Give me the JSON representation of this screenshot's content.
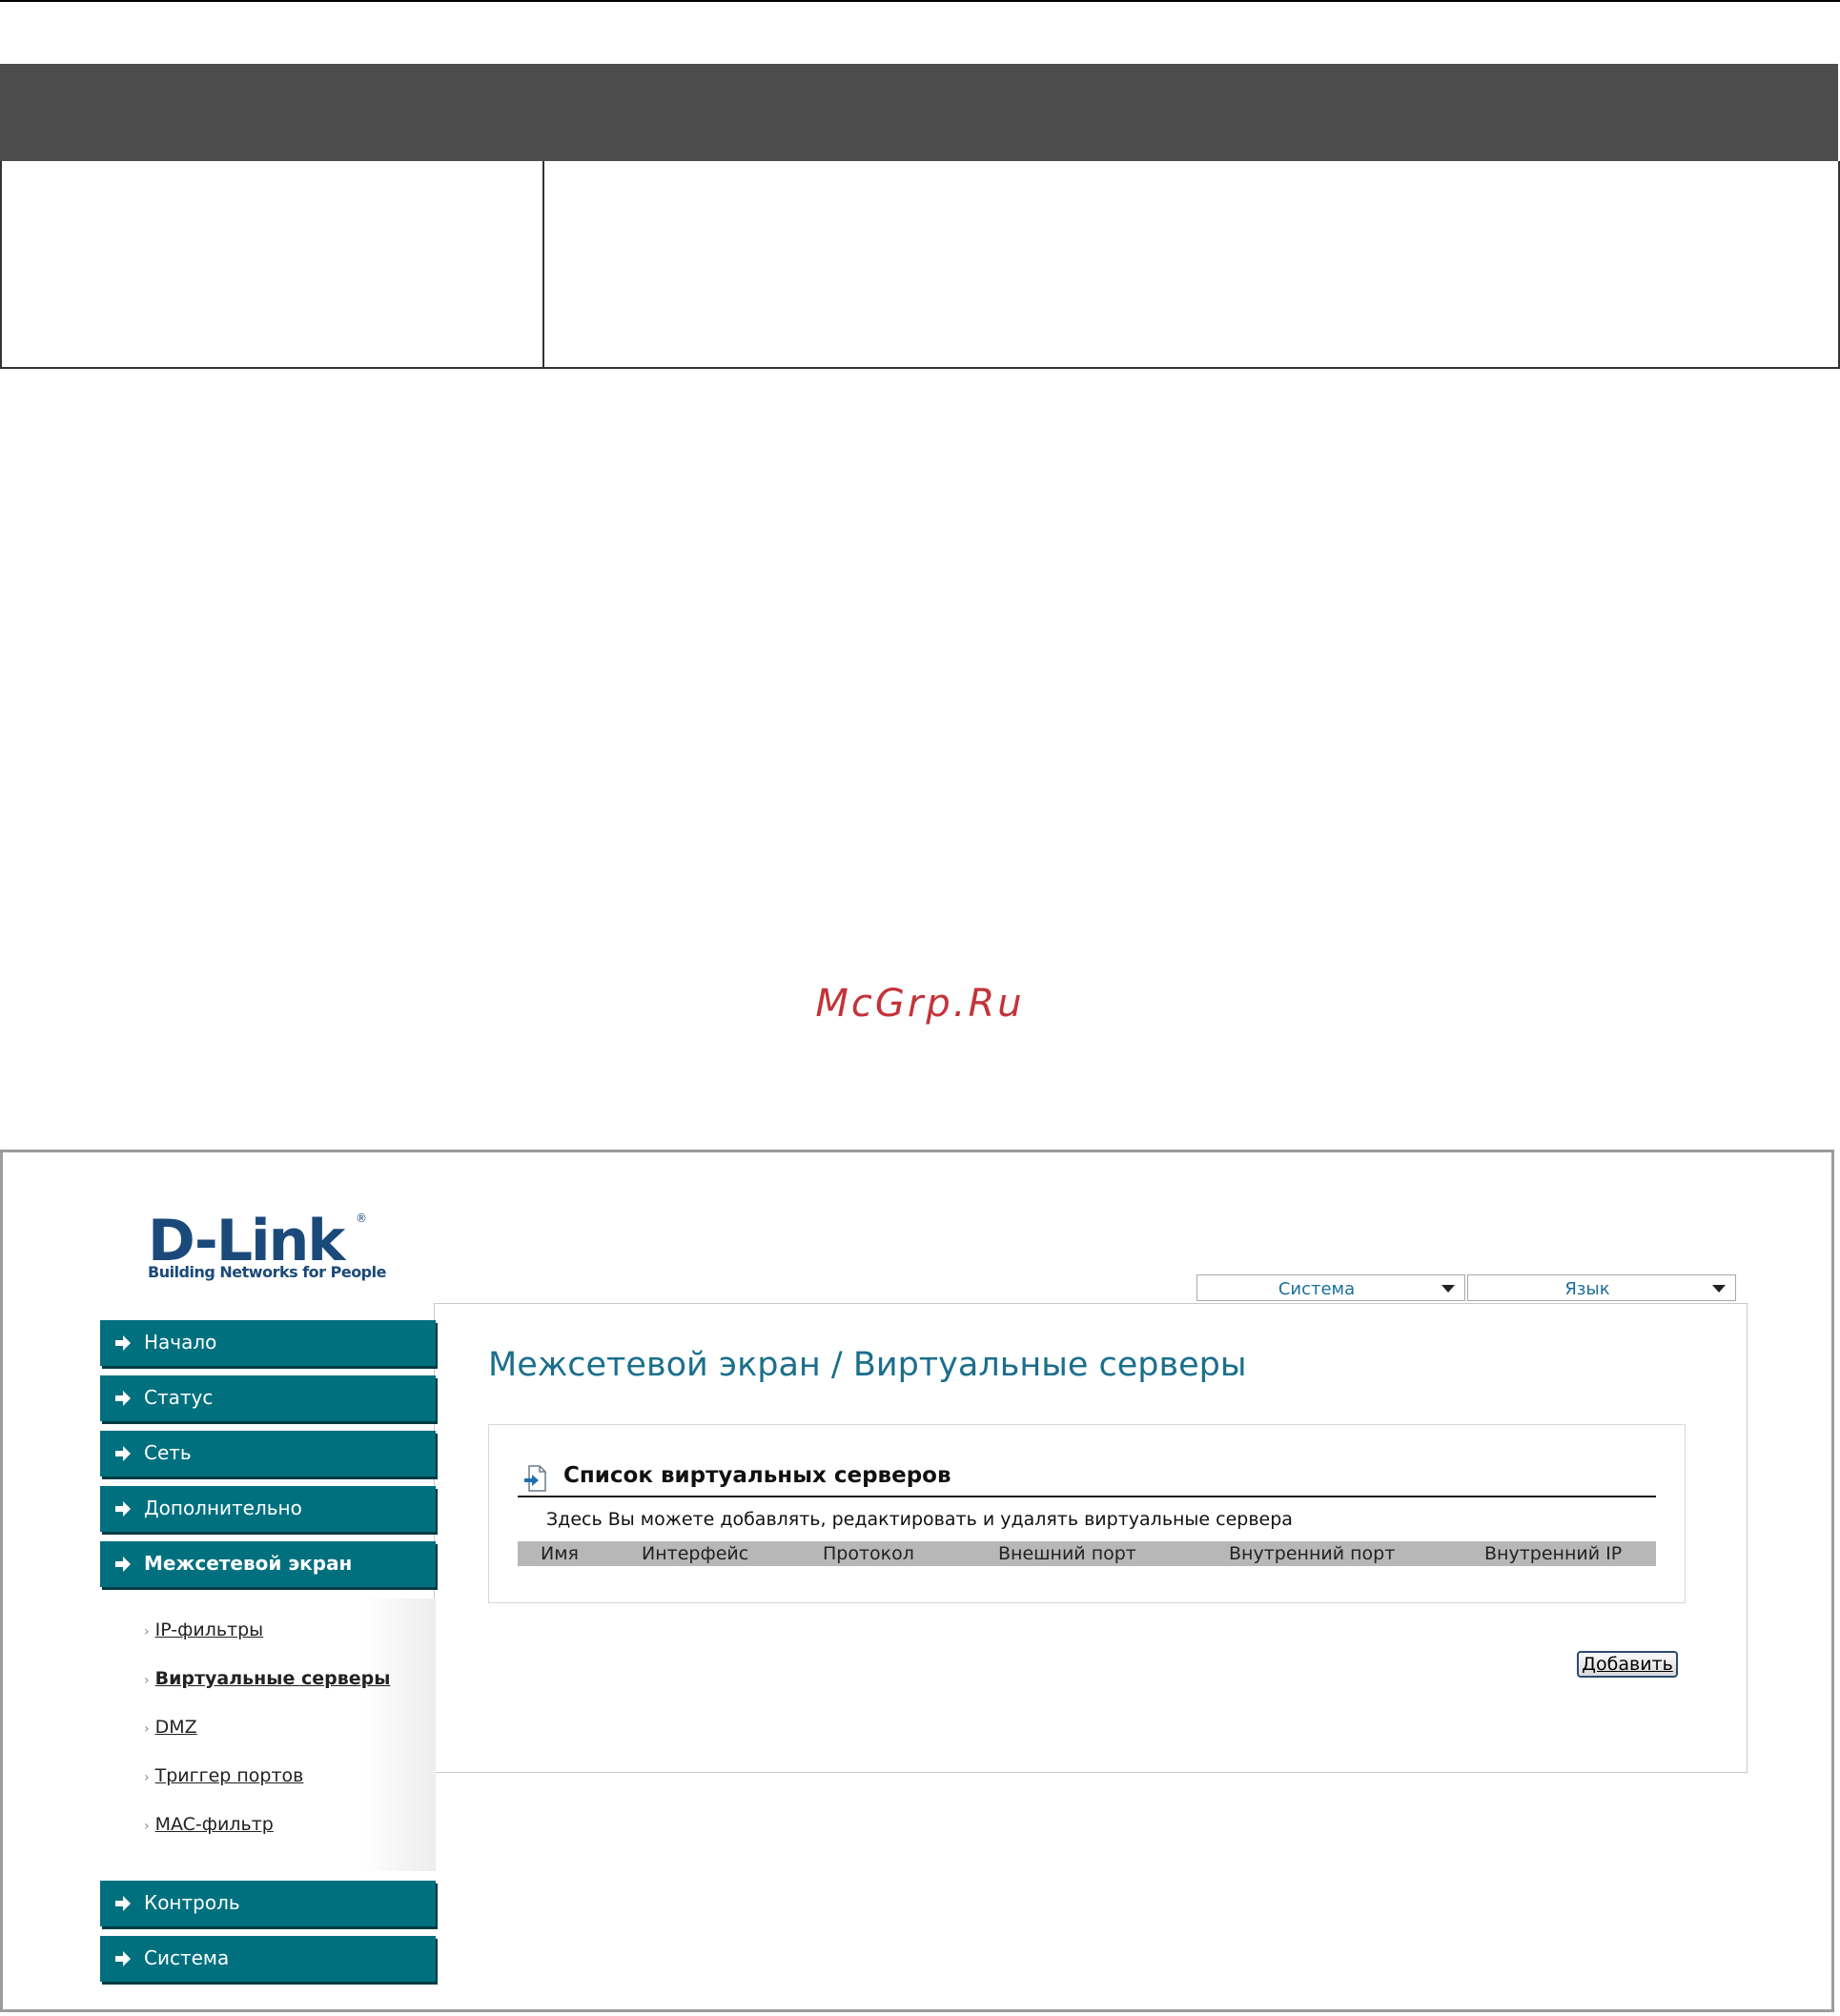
{
  "watermark": "McGrp.Ru",
  "screenshot": {
    "logo": {
      "brand": "D-Link",
      "registered": "®",
      "tagline": "Building Networks for People"
    },
    "top_menus": [
      {
        "label": "Система"
      },
      {
        "label": "Язык"
      }
    ],
    "sidebar": {
      "items": [
        {
          "label": "Начало"
        },
        {
          "label": "Статус"
        },
        {
          "label": "Сеть"
        },
        {
          "label": "Дополнительно"
        },
        {
          "label": "Межсетевой экран",
          "active": true
        },
        {
          "label": "Контроль"
        },
        {
          "label": "Система"
        }
      ],
      "subitems": [
        {
          "label": "IP-фильтры"
        },
        {
          "label": "Виртуальные серверы",
          "current": true
        },
        {
          "label": "DMZ"
        },
        {
          "label": "Триггер портов"
        },
        {
          "label": "MAC-фильтр"
        }
      ]
    },
    "page_title": "Межсетевой экран /  Виртуальные серверы",
    "section": {
      "title": "Список виртуальных серверов",
      "description": "Здесь Вы можете добавлять, редактировать и удалять виртуальные сервера",
      "columns": [
        "Имя",
        "Интерфейс",
        "Протокол",
        "Внешний порт",
        "Внутренний порт",
        "Внутренний IP"
      ]
    },
    "add_button": "Добавить"
  },
  "colors": {
    "nav_teal": "#00707f",
    "heading_teal": "#1b6f8c",
    "logo_blue": "#1b4a7a",
    "doc_header_gray": "#4d4d4d",
    "table_header_gray": "#b7b7b7",
    "watermark_red": "#c4333a"
  }
}
